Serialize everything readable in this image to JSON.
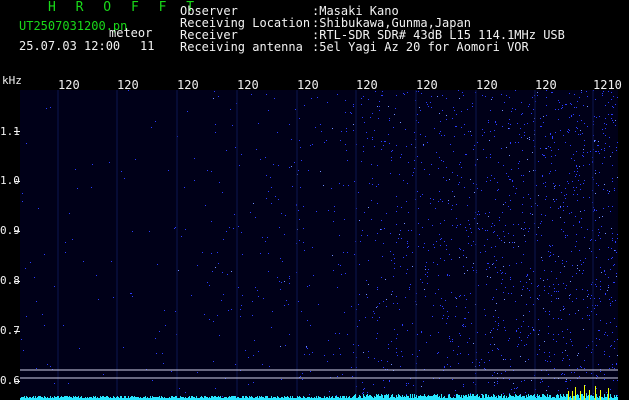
{
  "header": {
    "title": "H R O F F T",
    "filename": "UT2507031200.pn",
    "mode_label": "meteor",
    "datetime": "25.07.03 12:00",
    "count": "11"
  },
  "metadata": [
    {
      "key": "Observer",
      "value": ":Masaki Kano"
    },
    {
      "key": "Receiving Location",
      "value": ":Shibukawa,Gunma,Japan"
    },
    {
      "key": "Receiver",
      "value": ":RTL-SDR SDR# 43dB L15 114.1MHz USB"
    },
    {
      "key": "Receiving antenna",
      "value": ":5el Yagi Az 20 for Aomori VOR"
    }
  ],
  "colors": {
    "background": "#000000",
    "title_green": "#19d919",
    "text_white": "#f2f2f2",
    "noise_blue": "#2a3cff",
    "bright_blue": "#6f8bff",
    "baseline_cyan": "#27e6ff",
    "meteor_yellow": "#f2ff00"
  },
  "chart_data": {
    "type": "heatmap",
    "ylabel": "kHz",
    "y_ticks": [
      "1.1",
      "1.0",
      "0.9",
      "0.8",
      "0.7",
      "0.6"
    ],
    "x_ticks": [
      "120",
      "120",
      "120",
      "120",
      "120",
      "120",
      "120",
      "120",
      "120",
      "1210"
    ],
    "ylim": [
      0.58,
      1.2
    ],
    "description_levels": {
      "left_region_density": 0.05,
      "right_region_density": 0.85
    }
  }
}
